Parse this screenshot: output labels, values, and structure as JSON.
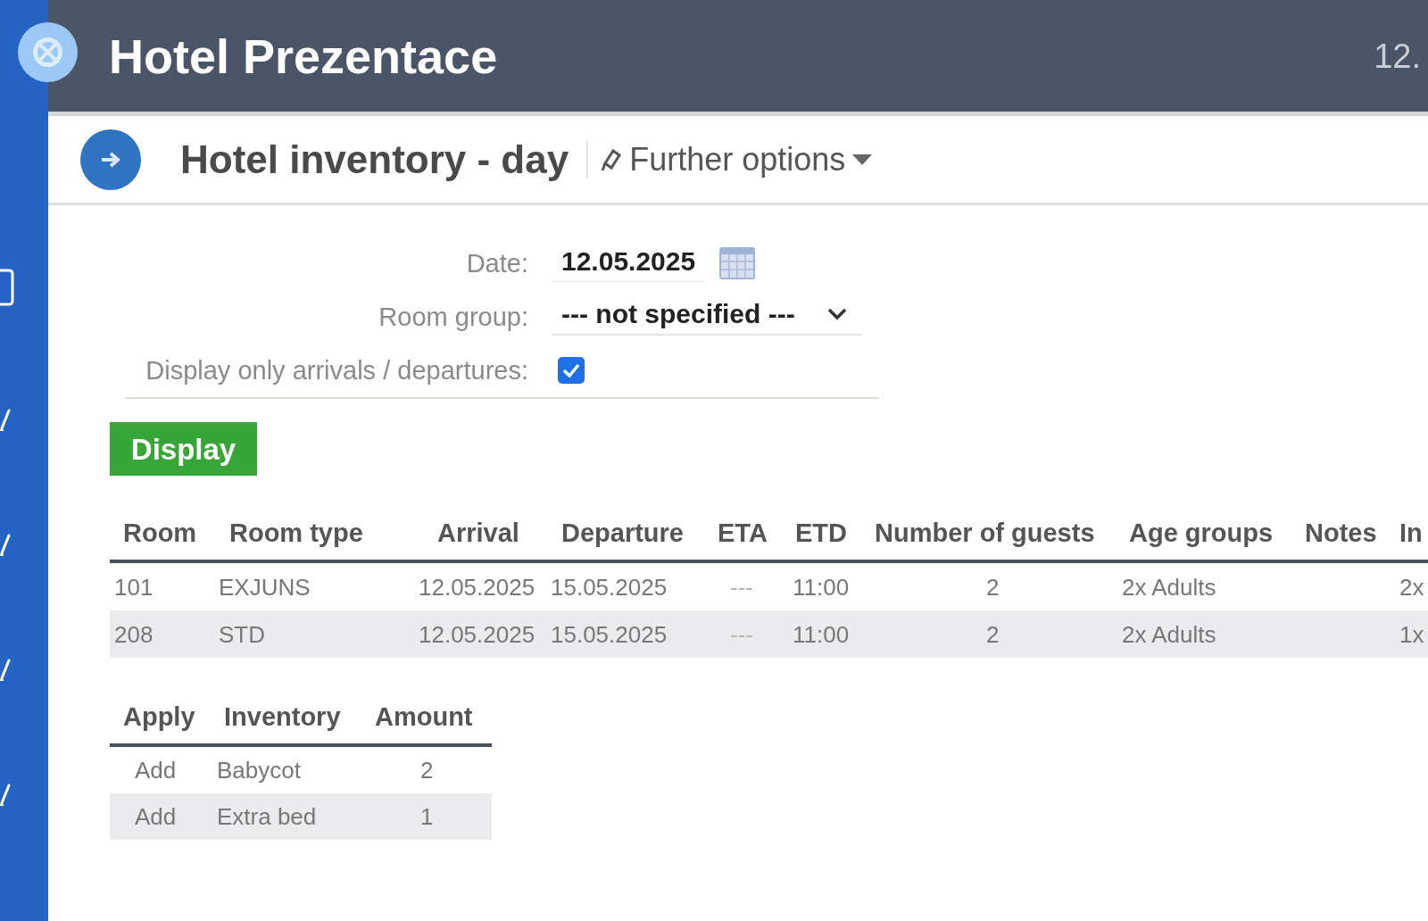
{
  "app": {
    "title": "Hotel Prezentace",
    "date_fragment": "12."
  },
  "toolbar": {
    "title": "Hotel inventory - day",
    "menu": "Further options"
  },
  "form": {
    "fields": [
      {
        "kind": "date",
        "label": "Date:",
        "value": "12.05.2025"
      },
      {
        "kind": "select",
        "label": "Room group:",
        "value": "--- not specified ---"
      },
      {
        "kind": "checkbox",
        "label": "Display only arrivals / departures:",
        "checked": true
      }
    ],
    "submit": "Display"
  },
  "reservations": {
    "columns": [
      "Room",
      "Room type",
      "Arrival",
      "Departure",
      "ETA",
      "ETD",
      "Number of guests",
      "Age groups",
      "Notes",
      "In"
    ],
    "rows": [
      {
        "room": "101",
        "room_type": "EXJUNS",
        "arrival": "12.05.2025",
        "departure": "15.05.2025",
        "eta": "---",
        "etd": "11:00",
        "guests": "2",
        "age_groups": "2x Adults",
        "column_10": "2x"
      },
      {
        "room": "208",
        "room_type": "STD",
        "arrival": "12.05.2025",
        "departure": "15.05.2025",
        "eta": "---",
        "etd": "11:00",
        "guests": "2",
        "age_groups": "2x Adults",
        "column_10": "1x"
      }
    ]
  },
  "inventory": {
    "columns": [
      "Apply",
      "Inventory",
      "Amount"
    ],
    "rows": [
      {
        "apply": "Add",
        "inventory": "Babycot",
        "amount": "2"
      },
      {
        "apply": "Add",
        "inventory": "Extra bed",
        "amount": "1"
      }
    ]
  }
}
